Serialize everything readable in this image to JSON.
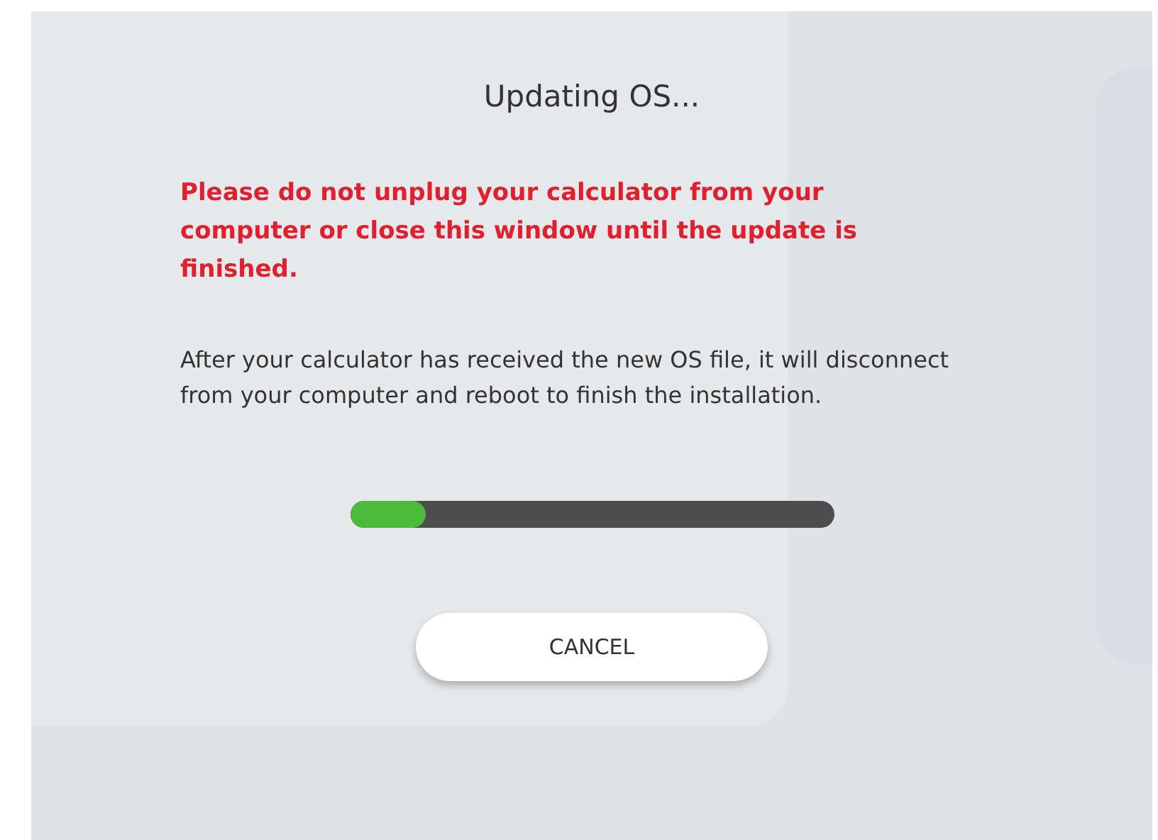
{
  "title": "Updating OS...",
  "warning": "Please do not unplug your calculator from your computer or close this window until the update is finished.",
  "info": "After your calculator has received the new OS file, it will disconnect from your computer and reboot to finish the installation.",
  "progress": {
    "level": 0.155
  },
  "buttons": [
    {
      "label": "CANCEL"
    }
  ]
}
